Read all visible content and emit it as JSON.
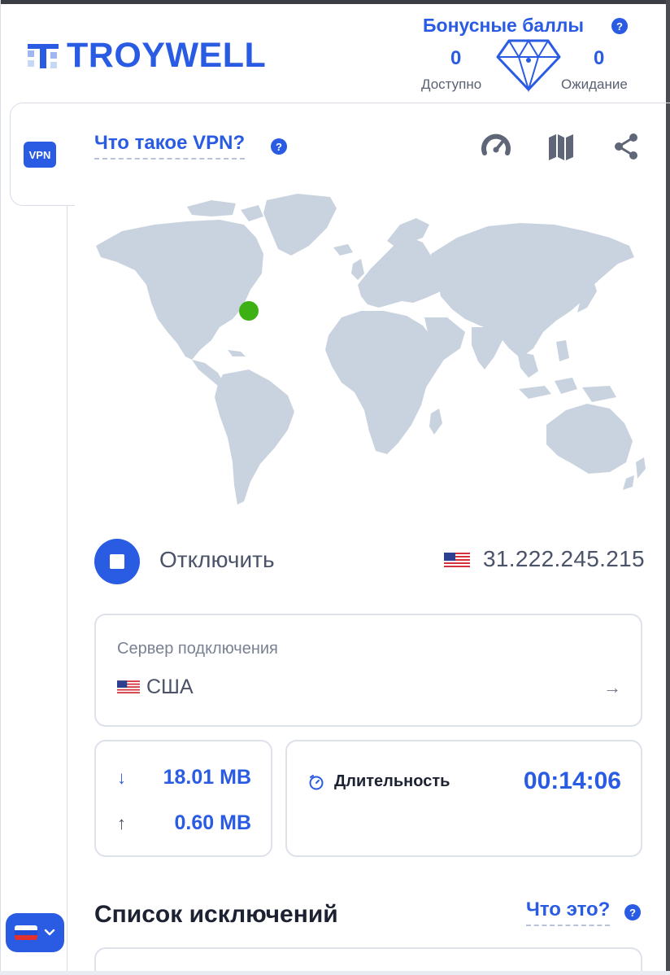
{
  "header": {
    "brand": "TROYWELL",
    "bonus": {
      "title": "Бонусные баллы",
      "help": "?",
      "available_value": "0",
      "available_label": "Доступно",
      "pending_value": "0",
      "pending_label": "Ожидание"
    }
  },
  "sidebar": {
    "tab_label": "VPN",
    "language_flag": "ru-flag-icon"
  },
  "vpn": {
    "what_is_vpn": "Что такое VPN?",
    "help": "?",
    "tools": [
      "speedometer-icon",
      "map-icon",
      "share-icon"
    ],
    "map": {
      "marker_color": "#3db014"
    },
    "connect_action": "Отключить",
    "ip_address": "31.222.245.215",
    "server": {
      "label": "Сервер подключения",
      "value": "США",
      "arrow": "→"
    },
    "traffic": {
      "download_arrow": "↓",
      "download": "18.01 MB",
      "upload_arrow": "↑",
      "upload": "0.60 MB"
    },
    "duration": {
      "label": "Длительность",
      "value": "00:14:06"
    },
    "exclusions": {
      "title": "Список исключений",
      "what_this": "Что это?",
      "help": "?"
    }
  },
  "colors": {
    "accent": "#2a5be3",
    "map_land": "#c9d3df",
    "text_muted": "#4b5368"
  }
}
